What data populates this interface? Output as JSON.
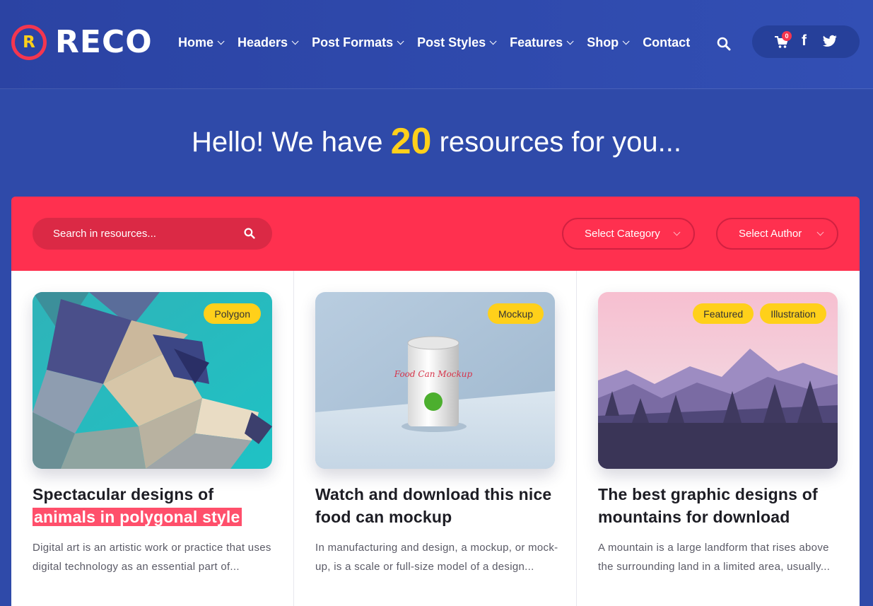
{
  "brand": {
    "logo_letter": "R",
    "name": "RECO"
  },
  "nav": {
    "items": [
      {
        "label": "Home",
        "has_dropdown": true
      },
      {
        "label": "Headers",
        "has_dropdown": true
      },
      {
        "label": "Post Formats",
        "has_dropdown": true
      },
      {
        "label": "Post Styles",
        "has_dropdown": true
      },
      {
        "label": "Features",
        "has_dropdown": true
      },
      {
        "label": "Shop",
        "has_dropdown": true
      },
      {
        "label": "Contact",
        "has_dropdown": false
      }
    ]
  },
  "header_actions": {
    "cart_count": "0",
    "facebook_glyph": "f",
    "icons": [
      "search-icon",
      "cart-icon",
      "facebook-icon",
      "twitter-icon"
    ]
  },
  "hero": {
    "prefix": "Hello! We have",
    "count": "20",
    "suffix": "resources for you..."
  },
  "filters": {
    "search_placeholder": "Search in resources...",
    "category_label": "Select Category",
    "author_label": "Select Author"
  },
  "cards": [
    {
      "tags": [
        "Polygon"
      ],
      "title_plain": "Spectacular designs of",
      "title_highlight": "animals in polygonal style",
      "excerpt": "Digital art is an artistic work or practice that uses digital technology as an essential part of..."
    },
    {
      "tags": [
        "Mockup"
      ],
      "title_plain": "Watch and download this nice food can mockup",
      "title_highlight": "",
      "excerpt": "In manufacturing and design, a mockup, or mock-up, is a scale or full-size model of a design...",
      "image_text": "Food Can Mockup"
    },
    {
      "tags": [
        "Featured",
        "Illustration"
      ],
      "title_plain": "The best graphic designs of mountains for download",
      "title_highlight": "",
      "excerpt": "A mountain is a large landform that rises above the surrounding land in a limited area, usually..."
    }
  ],
  "colors": {
    "header_blue": "#2f4aa9",
    "accent_red": "#ff304f",
    "accent_yellow": "#ffd01a"
  }
}
